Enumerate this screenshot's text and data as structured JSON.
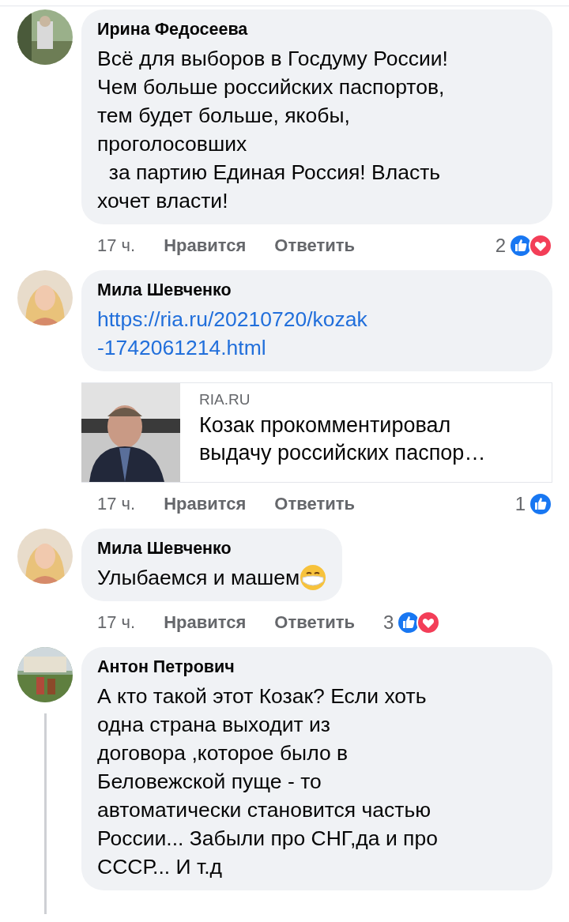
{
  "comments": [
    {
      "author": "Ирина Федосеева",
      "body": [
        {
          "kind": "text",
          "text": "Всё для выборов в Госдуму России!\nЧем больше российских паспортов,\nтем будет больше, якобы,\nпроголосовших\n  за партию Единая Россия! Власть\nхочет власти!"
        }
      ],
      "time": "17 ч.",
      "like_action": "Нравится",
      "reply_action": "Ответить",
      "reaction_count": "2",
      "reactions": [
        {
          "kind": "like"
        },
        {
          "kind": "love"
        }
      ],
      "thread_line": false
    },
    {
      "author": "Мила Шевченко",
      "body": [
        {
          "kind": "link",
          "text": "https://ria.ru/20210720/kozak\n-1742061214.html"
        }
      ],
      "preview": {
        "kind": "picture",
        "source": "RIA.RU",
        "title": "Козак прокомментировал\nвыдачу российских паспор…"
      },
      "time": "17 ч.",
      "like_action": "Нравится",
      "reply_action": "Ответить",
      "reaction_count": "1",
      "reactions": [
        {
          "kind": "like"
        }
      ],
      "thread_line": false
    },
    {
      "author": "Мила Шевченко",
      "body": [
        {
          "kind": "text",
          "text": "Улыбаемся и машем"
        },
        {
          "kind": "emoji"
        }
      ],
      "time": "17 ч.",
      "like_action": "Нравится",
      "reply_action": "Ответить",
      "reaction_count": "3",
      "reactions": [
        {
          "kind": "like"
        },
        {
          "kind": "love"
        }
      ],
      "thread_line": false
    },
    {
      "author": "Антон Петрович",
      "body": [
        {
          "kind": "text",
          "text": "А кто такой этот Козак? Если хоть\nодна страна выходит из\nдоговора ,которое было в\nБеловежской пуще - то\nавтоматически становится частью\nРоссии... Забыли про СНГ,да и про\nСССР... И т.д"
        }
      ],
      "thread_line": true
    }
  ]
}
